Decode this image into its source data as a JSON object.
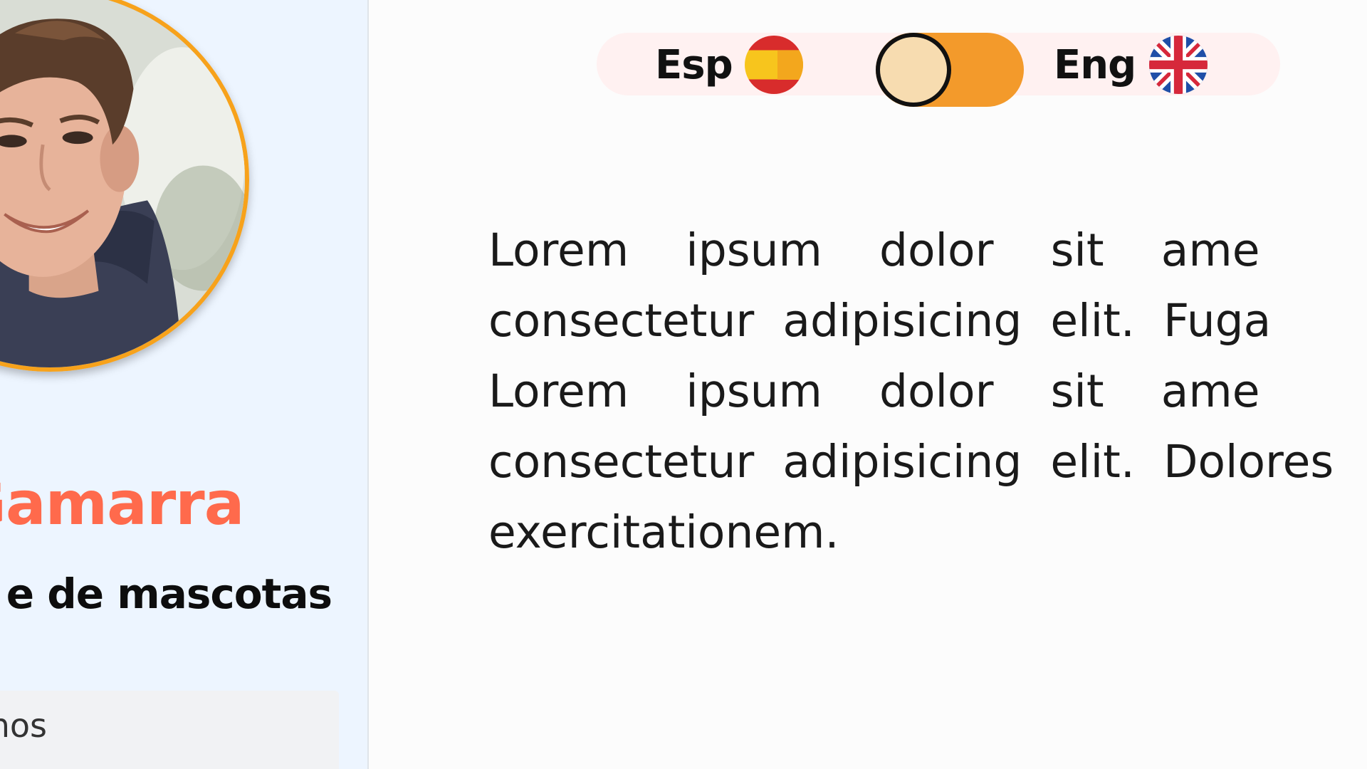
{
  "sidebar": {
    "profile_name": "Gamarra",
    "profile_role": "e de mascotas",
    "menu_item": "nos"
  },
  "language_switch": {
    "spanish_label": "Esp",
    "english_label": "Eng",
    "selected": "Esp",
    "toggle_color": "#f39a2b"
  },
  "content": {
    "lines": [
      "Lorem    ipsum    dolor    sit    ame",
      "consectetur  adipisicing  elit.  Fuga",
      "Lorem    ipsum    dolor    sit    ame",
      "consectetur  adipisicing  elit.  Dolores",
      "exercitationem."
    ]
  },
  "colors": {
    "accent_name": "#ff6a4c",
    "avatar_border": "#f7a21b",
    "sidebar_bg": "#edf5ff"
  }
}
